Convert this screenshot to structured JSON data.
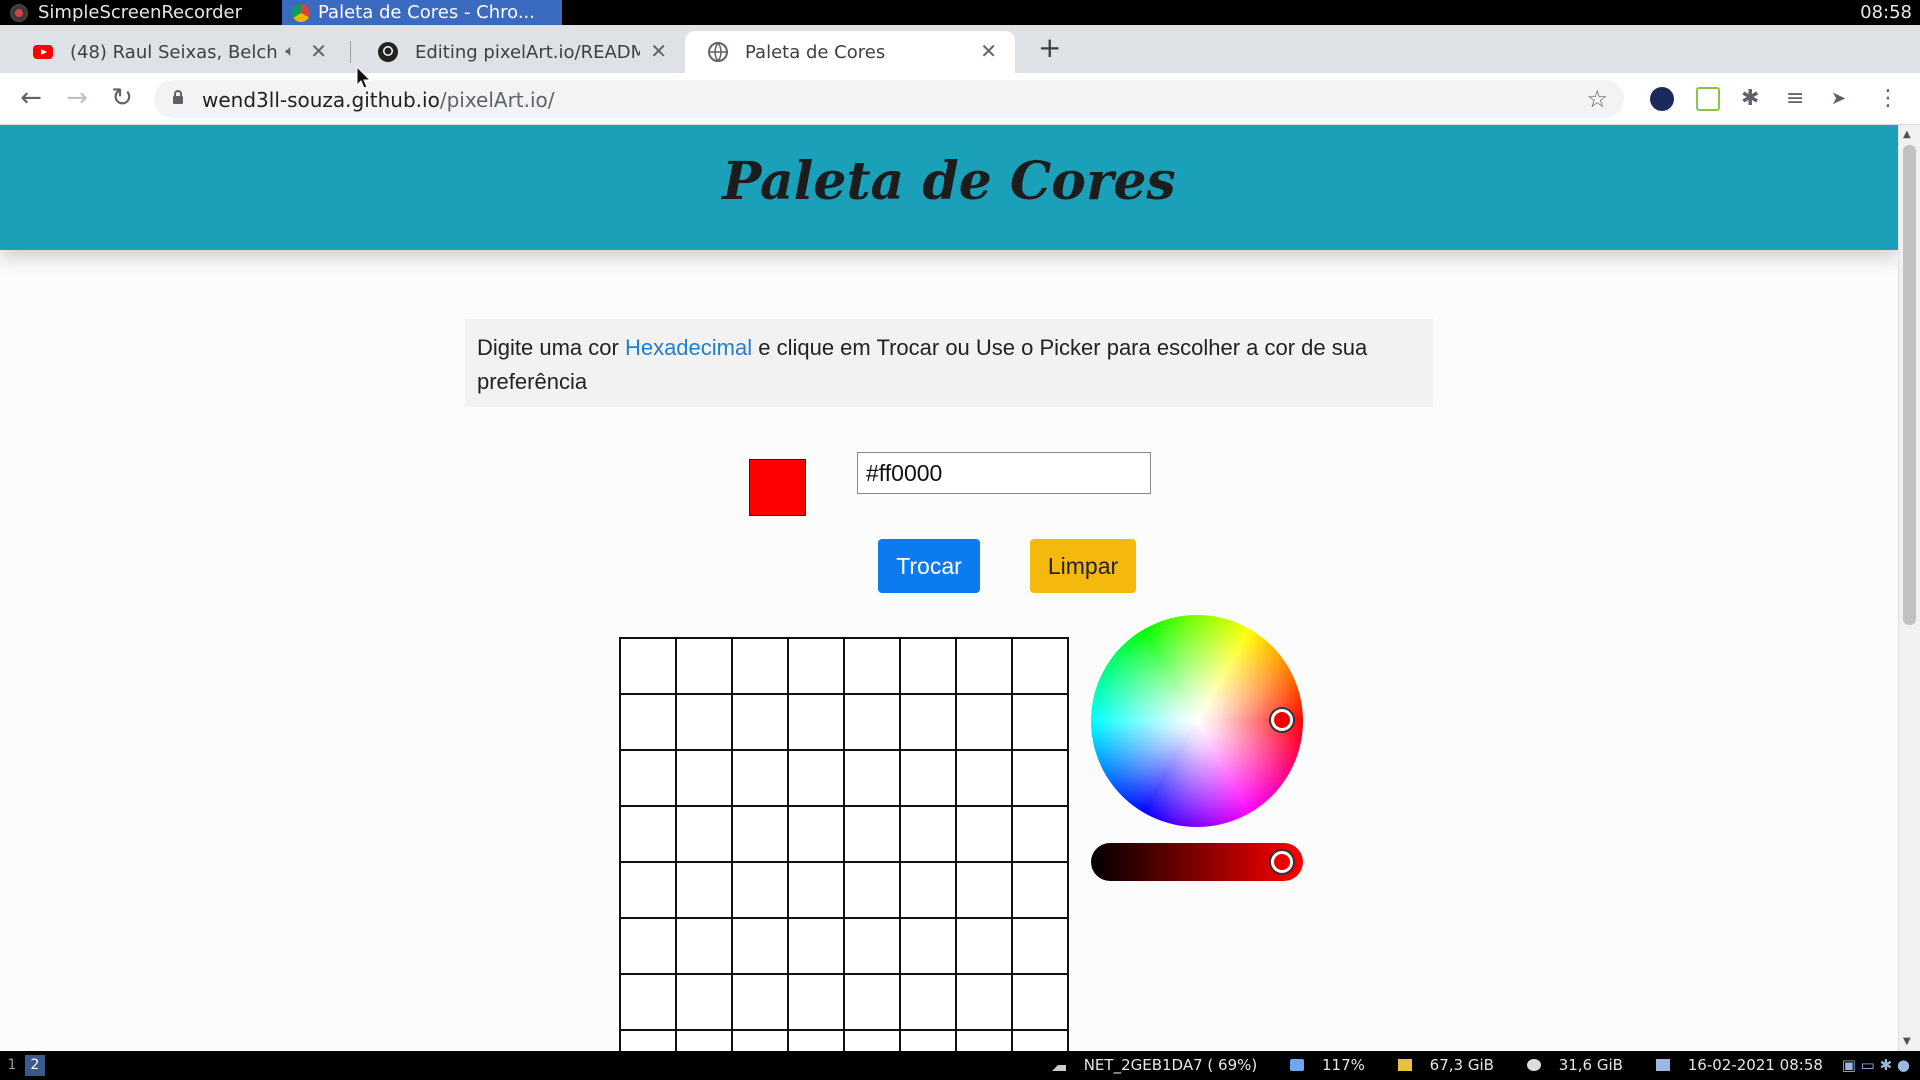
{
  "system_bar": {
    "tasks": [
      "SimpleScreenRecorder",
      "Paleta de Cores - Chro..."
    ],
    "clock": "08:58"
  },
  "browser": {
    "tabs": [
      {
        "label": "(48) Raul Seixas, Belch",
        "icon": "youtube-icon",
        "active": false
      },
      {
        "label": "Editing pixelArt.io/README",
        "icon": "github-icon",
        "active": false
      },
      {
        "label": "Paleta de Cores",
        "icon": "globe-icon",
        "active": true
      }
    ],
    "url_domain": "wend3ll-souza.github.io",
    "url_path": "/pixelArt.io/"
  },
  "page": {
    "title": "Paleta de Cores",
    "instructions_pre": "Digite uma cor ",
    "instructions_link": "Hexadecimal",
    "instructions_post": " e clique em Trocar ou Use o Picker para escolher a cor de sua preferência",
    "hex_value": "#ff0000",
    "swatch_color": "#ff0000",
    "trocar_label": "Trocar",
    "limpar_label": "Limpar",
    "grid_columns": 8,
    "grid_visible_rows": 8
  },
  "taskbar": {
    "workspaces": [
      "1",
      "2"
    ],
    "network": "NET_2GEB1DA7 ( 69%)",
    "volume": "117%",
    "disk1": "67,3 GiB",
    "disk2": "31,6 GiB",
    "datetime": "16-02-2021 08:58"
  }
}
